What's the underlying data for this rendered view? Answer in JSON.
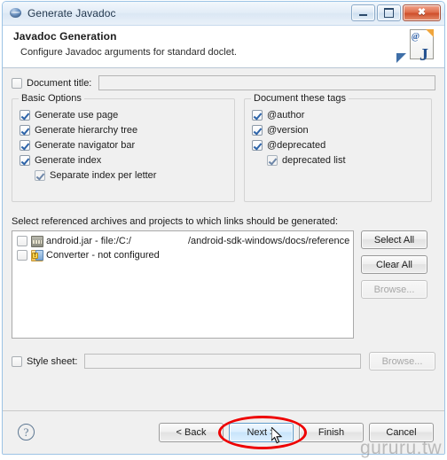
{
  "window": {
    "title": "Generate Javadoc",
    "icon": "globe-icon",
    "controls": {
      "minimize": "minimize-icon",
      "maximize": "maximize-icon",
      "close": "close-icon"
    }
  },
  "header": {
    "title": "Javadoc Generation",
    "subtitle": "Configure Javadoc arguments for standard doclet.",
    "icon": "javadoc-page-icon"
  },
  "document_title": {
    "label": "Document title:",
    "checked": false,
    "value": "",
    "placeholder": ""
  },
  "basic_options": {
    "title": "Basic Options",
    "items": [
      {
        "label": "Generate use page",
        "checked": true,
        "indent": false
      },
      {
        "label": "Generate hierarchy tree",
        "checked": true,
        "indent": false
      },
      {
        "label": "Generate navigator bar",
        "checked": true,
        "indent": false
      },
      {
        "label": "Generate index",
        "checked": true,
        "indent": false
      },
      {
        "label": "Separate index per letter",
        "checked": true,
        "indent": true
      }
    ]
  },
  "document_tags": {
    "title": "Document these tags",
    "items": [
      {
        "label": "@author",
        "checked": true,
        "indent": false
      },
      {
        "label": "@version",
        "checked": true,
        "indent": false
      },
      {
        "label": "@deprecated",
        "checked": true,
        "indent": false
      },
      {
        "label": "deprecated list",
        "checked": true,
        "indent": true
      }
    ]
  },
  "archives": {
    "label": "Select referenced archives and projects to which links should be generated:",
    "rows": [
      {
        "checked": false,
        "icon": "jar-icon",
        "name": "android.jar - file:/C:/",
        "path": "/android-sdk-windows/docs/reference"
      },
      {
        "checked": false,
        "icon": "folder-warning-icon",
        "name": "Converter - not configured",
        "path": ""
      }
    ],
    "buttons": [
      {
        "label": "Select All",
        "disabled": false
      },
      {
        "label": "Clear All",
        "disabled": false
      },
      {
        "label": "Browse...",
        "disabled": true
      }
    ]
  },
  "style_sheet": {
    "label": "Style sheet:",
    "checked": false,
    "value": "",
    "browse_label": "Browse...",
    "browse_disabled": true
  },
  "footer": {
    "help_icon": "help-question-icon",
    "buttons": [
      {
        "label": "< Back",
        "disabled": false,
        "primary": false
      },
      {
        "label": "Next >",
        "disabled": false,
        "primary": true
      },
      {
        "label": "Finish",
        "disabled": false,
        "primary": false
      },
      {
        "label": "Cancel",
        "disabled": false,
        "primary": false
      }
    ]
  },
  "annotation": {
    "shape": "ellipse",
    "color": "#ee0000",
    "target": "Next >"
  },
  "watermark": {
    "text": "gururu.tw"
  }
}
